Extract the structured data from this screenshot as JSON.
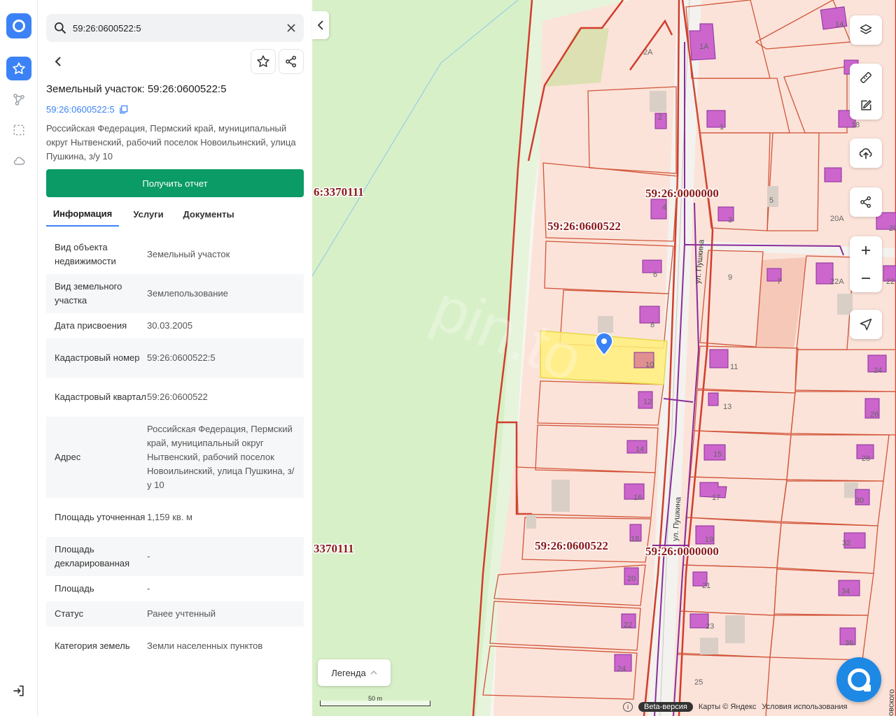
{
  "search": {
    "value": "59:26:0600522:5"
  },
  "object": {
    "title": "Земельный участок: 59:26:0600522:5",
    "cadastral_link": "59:26:0600522:5",
    "address": "Российская Федерация, Пермский край, муниципальный округ Нытвенский, рабочий поселок Новоильинский, улица Пушкина, з/у 10"
  },
  "report_button": "Получить отчет",
  "tabs": [
    {
      "label": "Информация",
      "active": true
    },
    {
      "label": "Услуги",
      "active": false
    },
    {
      "label": "Документы",
      "active": false
    }
  ],
  "info_rows": [
    {
      "key": "Вид объекта недвижимости",
      "value": "Земельный участок"
    },
    {
      "key": "Вид земельного участка",
      "value": "Землепользование"
    },
    {
      "key": "Дата присвоения",
      "value": "30.03.2005"
    },
    {
      "key": "Кадастровый номер",
      "value": "59:26:0600522:5"
    },
    {
      "key": "Кадастровый квартал",
      "value": "59:26:0600522"
    },
    {
      "key": "Адрес",
      "value": "Российская Федерация, Пермский край, муниципальный округ Нытвенский, рабочий поселок Новоильинский, улица Пушкина, з/у 10"
    },
    {
      "key": "Площадь уточненная",
      "value": "1,159 кв. м"
    },
    {
      "key": "Площадь декларированная",
      "value": "-"
    },
    {
      "key": "Площадь",
      "value": "-"
    },
    {
      "key": "Статус",
      "value": "Ранее учтенный"
    },
    {
      "key": "Категория земель",
      "value": "Земли населенных пунктов"
    }
  ],
  "map": {
    "quarter_labels": {
      "q_3370111_top": "6:3370111",
      "q_0000000_top": "59:26:0000000",
      "q_0600522_top": "59:26:0600522",
      "q_3370111_bottom": "3370111",
      "q_0600522_bottom": "59:26:0600522",
      "q_0000000_bottom": "59:26:0000000"
    },
    "street_labels": {
      "top": "ул. Пушкина",
      "bottom": "ул. Пушкина",
      "edge": "овского"
    },
    "parcel_numbers": [
      "2А",
      "1А",
      "14",
      "2",
      "1",
      "18",
      "4",
      "3",
      "5",
      "20А",
      "20",
      "6",
      "9",
      "7",
      "22А",
      "22",
      "8",
      "11",
      "10",
      "24",
      "12",
      "13",
      "26",
      "14",
      "15",
      "28",
      "16",
      "17",
      "30",
      "18",
      "19",
      "32",
      "20",
      "21",
      "34",
      "22",
      "23",
      "36",
      "24",
      "25"
    ],
    "watermark": "pin.to"
  },
  "legend_label": "Легенда",
  "scale_label": "50 m",
  "attribution": {
    "beta": "Beta-версия",
    "maps": "Карты © Яндекс",
    "terms": "Условия использования",
    "info": "i"
  },
  "colors": {
    "accent": "#3b82f6",
    "report": "#0a9b67",
    "parcel_line": "#d23c2c",
    "building": "#cc66cc",
    "selected": "#fff07a",
    "forest": "#d8f0c8"
  }
}
